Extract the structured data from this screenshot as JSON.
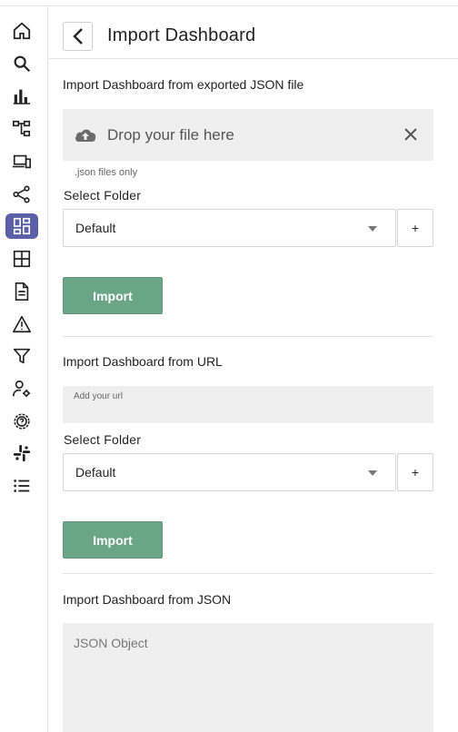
{
  "header": {
    "title": "Import Dashboard"
  },
  "sidebar": {
    "icons": [
      "home-icon",
      "search-icon",
      "bar-chart-icon",
      "hierarchy-icon",
      "devices-icon",
      "share-nodes-icon",
      "dashboard-icon",
      "grid-icon",
      "document-icon",
      "warning-icon",
      "filter-icon",
      "user-settings-icon",
      "help-settings-icon",
      "slack-icon",
      "list-icon"
    ],
    "active": "dashboard-icon",
    "accent": "#5a5fa8"
  },
  "file_section": {
    "title": "Import Dashboard from exported JSON file",
    "drop_text": "Drop your file here",
    "hint": ".json files only",
    "folder_label": "Select Folder",
    "folder_value": "Default",
    "plus_label": "+",
    "import_label": "Import"
  },
  "url_section": {
    "title": "Import Dashboard from URL",
    "url_placeholder": "Add your url",
    "folder_label": "Select Folder",
    "folder_value": "Default",
    "plus_label": "+",
    "import_label": "Import"
  },
  "json_section": {
    "title": "Import Dashboard from JSON",
    "placeholder": "JSON Object"
  },
  "colors": {
    "import_button": "#6aa586",
    "input_bg": "#efefef"
  }
}
